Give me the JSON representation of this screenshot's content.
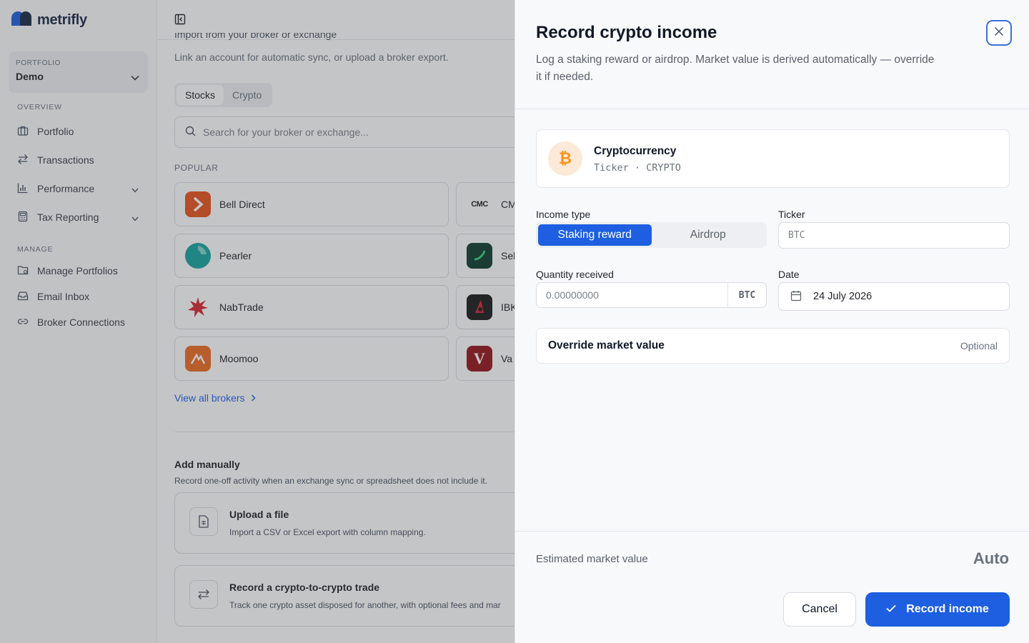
{
  "app": {
    "name": "metrifly"
  },
  "sidebar": {
    "portfolio_label": "PORTFOLIO",
    "portfolio_value": "Demo",
    "overview_label": "OVERVIEW",
    "overview_items": [
      {
        "label": "Portfolio",
        "icon": "briefcase-icon"
      },
      {
        "label": "Transactions",
        "icon": "arrows-swap-icon"
      },
      {
        "label": "Performance",
        "icon": "bar-chart-icon"
      },
      {
        "label": "Tax Reporting",
        "icon": "calculator-icon"
      }
    ],
    "manage_label": "MANAGE",
    "manage_items": [
      {
        "label": "Manage Portfolios",
        "icon": "folder-icon"
      },
      {
        "label": "Email Inbox",
        "icon": "inbox-icon"
      },
      {
        "label": "Broker Connections",
        "icon": "link-icon"
      }
    ]
  },
  "main": {
    "import_title": "Import from your broker or exchange",
    "import_subtitle": "Link an account for automatic sync, or upload a broker export.",
    "tabs": [
      {
        "label": "Stocks"
      },
      {
        "label": "Crypto"
      }
    ],
    "search_placeholder": "Search for your broker or exchange...",
    "popular_label": "POPULAR",
    "brokers": [
      {
        "name": "Bell Direct"
      },
      {
        "name": "CMC Markets",
        "visible_text": "CM",
        "logo_text": "CMC"
      },
      {
        "name": "Pearler"
      },
      {
        "name": "Selfwealth",
        "visible_text": "Sel"
      },
      {
        "name": "NabTrade"
      },
      {
        "name": "IBKR",
        "visible_text": "IBK"
      },
      {
        "name": "Moomoo"
      },
      {
        "name": "Vanguard",
        "visible_text": "Va",
        "logo_text": "V"
      }
    ],
    "view_all": "View all brokers",
    "add_manually_title": "Add manually",
    "add_manually_subtitle": "Record one-off activity when an exchange sync or spreadsheet does not include it.",
    "cards": [
      {
        "title": "Upload a file",
        "desc": "Import a CSV or Excel export with column mapping."
      },
      {
        "title": "Record a crypto-to-crypto trade",
        "desc": "Track one crypto asset disposed for another, with optional fees and mar"
      }
    ]
  },
  "panel": {
    "title": "Record crypto income",
    "subtitle": "Log a staking reward or airdrop. Market value is derived automatically — override it if needed.",
    "asset": {
      "name": "Cryptocurrency",
      "meta": "Ticker · CRYPTO",
      "icon_glyph": "₿"
    },
    "income_type_label": "Income type",
    "income_types": [
      {
        "label": "Staking reward",
        "selected": true
      },
      {
        "label": "Airdrop",
        "selected": false
      }
    ],
    "ticker_label": "Ticker",
    "ticker_placeholder": "BTC",
    "quantity_label": "Quantity received",
    "quantity_placeholder": "0.00000000",
    "quantity_unit": "BTC",
    "date_label": "Date",
    "date_value": "24 July 2026",
    "override_title": "Override market value",
    "override_optional": "Optional",
    "estimated_label": "Estimated market value",
    "estimated_value": "Auto",
    "cancel_label": "Cancel",
    "record_label": "Record income"
  },
  "colors": {
    "accent": "#1d5fe0",
    "brand": "#1b2a4a",
    "bitcoin": "#f7931a"
  }
}
